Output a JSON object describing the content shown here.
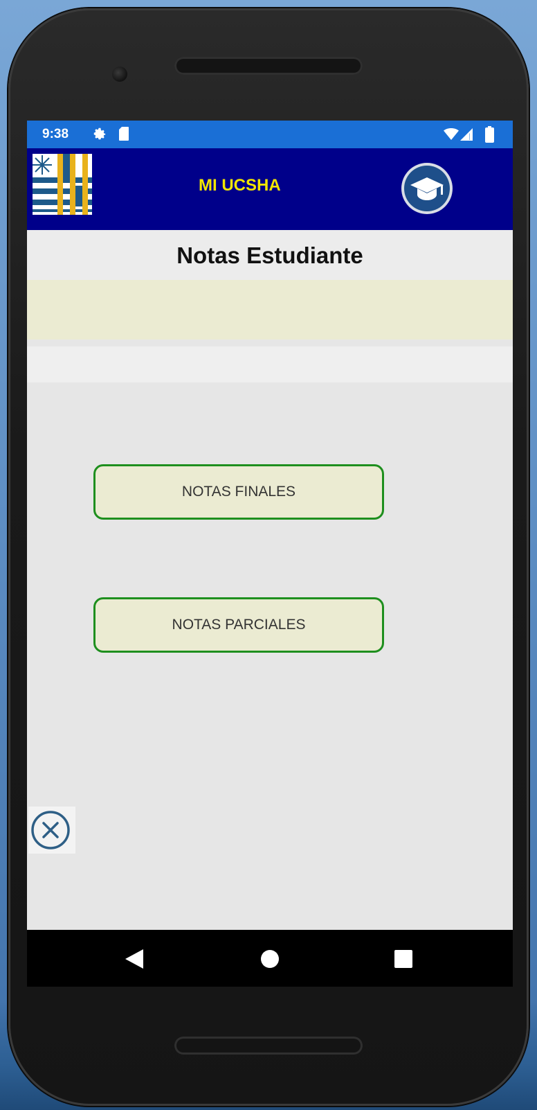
{
  "status_bar": {
    "time": "9:38",
    "icons": [
      "settings-icon",
      "sd-card-icon",
      "wifi-icon",
      "signal-icon",
      "battery-icon"
    ]
  },
  "app_bar": {
    "title": "MI UCSHA",
    "logo": "ucsha-logo",
    "action_icon": "graduation-cap-icon"
  },
  "page": {
    "title": "Notas Estudiante"
  },
  "menu": {
    "finales_label": "NOTAS FINALES",
    "parciales_label": "NOTAS PARCIALES"
  },
  "floating": {
    "icon": "close-circle-icon"
  },
  "nav_bar": {
    "icons": [
      "back-icon",
      "home-icon",
      "recents-icon"
    ]
  },
  "colors": {
    "status_bar": "#1a6fd6",
    "app_bar": "#00008a",
    "app_title": "#f2e600",
    "button_border": "#1e8f1e",
    "button_fill": "#ebebd2",
    "screen_bg": "#e6e6e6"
  }
}
